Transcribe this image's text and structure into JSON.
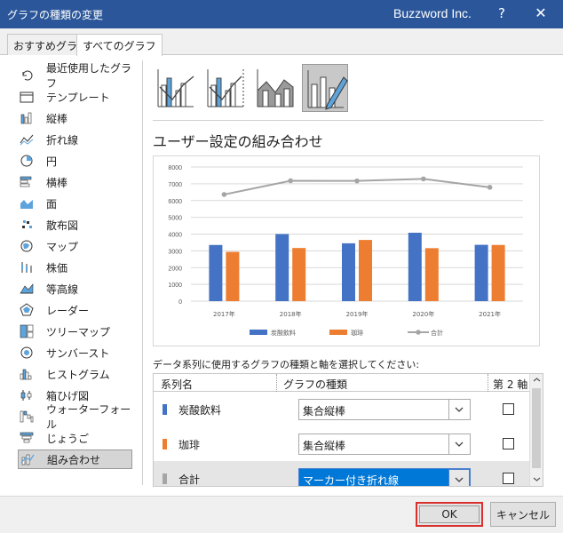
{
  "window": {
    "title": "グラフの種類の変更",
    "brand": "Buzzword Inc.",
    "help": "?",
    "close": "✕"
  },
  "tabs": [
    {
      "label": "おすすめグラフ"
    },
    {
      "label": "すべてのグラフ"
    }
  ],
  "sidebar": {
    "selected_index": 16,
    "items": [
      {
        "label": "最近使用したグラフ",
        "icon": "recent-icon"
      },
      {
        "label": "テンプレート",
        "icon": "folder-icon"
      },
      {
        "label": "縦棒",
        "icon": "column-chart-icon"
      },
      {
        "label": "折れ線",
        "icon": "line-chart-icon"
      },
      {
        "label": "円",
        "icon": "pie-chart-icon"
      },
      {
        "label": "横棒",
        "icon": "bar-chart-icon"
      },
      {
        "label": "面",
        "icon": "area-chart-icon"
      },
      {
        "label": "散布図",
        "icon": "scatter-chart-icon"
      },
      {
        "label": "マップ",
        "icon": "map-chart-icon"
      },
      {
        "label": "株価",
        "icon": "stock-chart-icon"
      },
      {
        "label": "等高線",
        "icon": "surface-chart-icon"
      },
      {
        "label": "レーダー",
        "icon": "radar-chart-icon"
      },
      {
        "label": "ツリーマップ",
        "icon": "treemap-chart-icon"
      },
      {
        "label": "サンバースト",
        "icon": "sunburst-chart-icon"
      },
      {
        "label": "ヒストグラム",
        "icon": "histogram-chart-icon"
      },
      {
        "label": "箱ひげ図",
        "icon": "boxwhisker-chart-icon"
      },
      {
        "label": "ウォーターフォール",
        "icon": "waterfall-chart-icon"
      },
      {
        "label": "じょうご",
        "icon": "funnel-chart-icon"
      },
      {
        "label": "組み合わせ",
        "icon": "combo-chart-icon"
      }
    ]
  },
  "combo_types": [
    {
      "icon": "clustered-column-line-icon"
    },
    {
      "icon": "clustered-column-line-secondary-icon"
    },
    {
      "icon": "stacked-area-column-icon"
    },
    {
      "icon": "custom-combo-icon"
    }
  ],
  "main": {
    "subtitle": "ユーザー設定の組み合わせ",
    "select_prompt": "データ系列に使用するグラフの種類と軸を選択してください:"
  },
  "chart_data": {
    "type": "bar",
    "categories": [
      "2017年",
      "2018年",
      "2019年",
      "2020年",
      "2021年"
    ],
    "ylim": [
      0,
      8000
    ],
    "yticks": [
      "0",
      "1000",
      "2000",
      "3000",
      "4000",
      "5000",
      "6000",
      "7000",
      "8000"
    ],
    "grid": true,
    "legend": "bottom",
    "series": [
      {
        "name": "炭酸飲料",
        "kind": "bar",
        "color": "#4472c4",
        "values": [
          3350,
          4000,
          3450,
          4080,
          3360
        ]
      },
      {
        "name": "珈琲",
        "kind": "bar",
        "color": "#ed7d31",
        "values": [
          2940,
          3170,
          3650,
          3160,
          3350
        ]
      },
      {
        "name": "合計",
        "kind": "line-marker",
        "color": "#a5a5a5",
        "values": [
          6360,
          7180,
          7170,
          7290,
          6790
        ]
      }
    ]
  },
  "series_table": {
    "headers": {
      "name": "系列名",
      "type": "グラフの種類",
      "axis": "第 2 軸"
    },
    "rows": [
      {
        "name": "炭酸飲料",
        "color": "#4472c4",
        "type": "集合縦棒",
        "secondary": false,
        "selected": false
      },
      {
        "name": "珈琲",
        "color": "#ed7d31",
        "type": "集合縦棒",
        "secondary": false,
        "selected": false
      },
      {
        "name": "合計",
        "color": "#a5a5a5",
        "type": "マーカー付き折れ線",
        "secondary": false,
        "selected": true
      }
    ]
  },
  "footer": {
    "ok": "OK",
    "cancel": "キャンセル"
  }
}
